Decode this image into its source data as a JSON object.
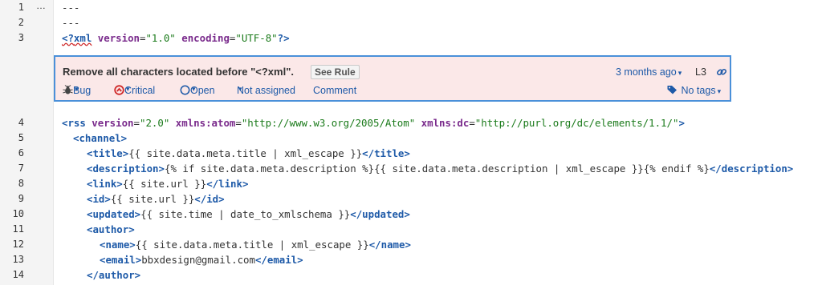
{
  "gutter": {
    "line_numbers": [
      "1",
      "2",
      "3",
      "4",
      "5",
      "6",
      "7",
      "8",
      "9",
      "10",
      "11",
      "12",
      "13",
      "14"
    ],
    "expand_marker": "…"
  },
  "code_lines": {
    "l1": "---",
    "l2": "---",
    "l3": {
      "open": "<?",
      "tag": "xml",
      "a1": " version",
      "eq1": "=",
      "v1": "\"1.0\"",
      "a2": " encoding",
      "eq2": "=",
      "v2": "\"UTF-8\"",
      "close": "?>"
    },
    "l4": {
      "open": "<rss",
      "a1": " version",
      "eq1": "=",
      "v1": "\"2.0\"",
      "a2": " xmlns:atom",
      "eq2": "=",
      "v2": "\"http://www.w3.org/2005/Atom\"",
      "a3": " xmlns:dc",
      "eq3": "=",
      "v3": "\"http://purl.org/dc/elements/1.1/\"",
      "close": ">"
    },
    "l5": {
      "open": "<channel>"
    },
    "l6": {
      "open": "<title>",
      "text": "{{ site.data.meta.title | xml_escape }}",
      "close": "</title>"
    },
    "l7": {
      "open": "<description>",
      "text": "{% if site.data.meta.description %}{{ site.data.meta.description | xml_escape }}{% endif %}",
      "close": "</description>"
    },
    "l8": {
      "open": "<link>",
      "text": "{{ site.url }}",
      "close": "</link>"
    },
    "l9": {
      "open": "<id>",
      "text": "{{ site.url }}",
      "close": "</id>"
    },
    "l10": {
      "open": "<updated>",
      "text": "{{ site.time | date_to_xmlschema }}",
      "close": "</updated>"
    },
    "l11": {
      "open": "<author>"
    },
    "l12": {
      "open": "<name>",
      "text": "{{ site.data.meta.title | xml_escape }}",
      "close": "</name>"
    },
    "l13": {
      "open": "<email>",
      "text": "bbxdesign@gmail.com",
      "close": "</email>"
    },
    "l14": {
      "open": "</author>"
    }
  },
  "issue": {
    "message": "Remove all characters located before \"<?xml\".",
    "see_rule": "See Rule",
    "age": "3 months ago",
    "location": "L3",
    "type": "Bug",
    "severity": "Critical",
    "status": "Open",
    "assignee": "Not assigned",
    "comment": "Comment",
    "tags": "No tags",
    "caret": "▾",
    "colors": {
      "accent": "#4a90d9",
      "link": "#1e5aa8",
      "critical": "#d02b2b",
      "background": "#fbe8e8"
    },
    "icons": [
      "bug-icon",
      "critical-icon",
      "open-status-icon",
      "tag-icon",
      "permalink-icon"
    ]
  }
}
